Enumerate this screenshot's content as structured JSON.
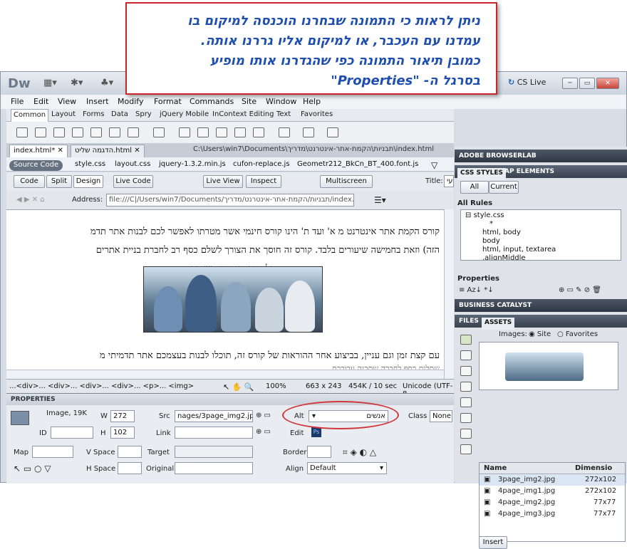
{
  "callout": {
    "lines": [
      "ניתן לראות כי התמונה שבחרנו הוכנסה למיקום בו",
      "עמדנו עם העכבר, או למיקום אליו גררנו אותה.",
      "כמובן תיאור התמונה כפי שהגדרנו אותו מופיע",
      "בסרגל ה- \"Properties\""
    ]
  },
  "app": {
    "logo": "Dw",
    "cs_live": "CS Live"
  },
  "menu": [
    "File",
    "Edit",
    "View",
    "Insert",
    "Modify",
    "Format",
    "Commands",
    "Site",
    "Window",
    "Help"
  ],
  "insert_tabs": [
    "Common",
    "Layout",
    "Forms",
    "Data",
    "Spry",
    "jQuery Mobile",
    "InContext Editing",
    "Text",
    "Favorites"
  ],
  "doc_tabs": [
    "index.html*",
    "הדגמה שליט.html"
  ],
  "doc_path": "C:\\Users\\win7\\Documents\\תבניות\\הקמת-אתר-אינטרנט\\מדריך\\index.html",
  "related_files": [
    "Source Code",
    "style.css",
    "layout.css",
    "jquery-1.3.2.min.js",
    "cufon-replace.js",
    "Geometr212_BkCn_BT_400.font.js"
  ],
  "view_buttons": [
    "Code",
    "Split",
    "Design",
    "Live Code",
    "Live View",
    "Inspect",
    "Multiscreen"
  ],
  "title_label": "Title:",
  "title_value": "עי",
  "address_label": "Address:",
  "address_value": "file:///C|/Users/win7/Documents/תבניות/הקמת-אתר-אינטרנט/מדריך/index.",
  "body_text": {
    "l1": "קורס הקמת אתר אינטרנט מ א' ועד ת' הינו קורס חינמי אשר מטרתו לאפשר לכם לבנות אתר תדמ",
    "l2": "הזה) וזאת בחמישה שיעורים בלבד. קורס זה חוסך את הצורך לשלם כסף רב לחברת בניית אתרים",
    "l3": "תלוי בה בעדכונו השוטף.",
    "l4": "עם קצת זמן וגם עניין, בביצוע אחר ההוראות של קורס זה, תוכלו לבנות בעצמכם אתר תדמיתי מ",
    "l5": "שתלום כסף לחברה שתבנה עבורכם"
  },
  "status": {
    "tags": "...<div>... <div>... <div>... <div>... <p>... <img>",
    "zoom": "100%",
    "dims": "663 x 243",
    "size": "454K / 10 sec",
    "encoding": "Unicode (UTF-8"
  },
  "properties": {
    "header": "PROPERTIES",
    "image_info": "Image, 19K",
    "w_label": "W",
    "w": "272",
    "h_label": "H",
    "h": "102",
    "id_label": "ID",
    "id": "",
    "src_label": "Src",
    "src": "nages/3page_img2.jpg",
    "link_label": "Link",
    "link": "",
    "alt_label": "Alt",
    "alt": "אנשים",
    "edit_label": "Edit",
    "class_label": "Class",
    "class": "None",
    "map_label": "Map",
    "vspace_label": "V Space",
    "hspace_label": "H Space",
    "target_label": "Target",
    "original_label": "Original",
    "border_label": "Border",
    "align_label": "Align",
    "align": "Default"
  },
  "right": {
    "browserlab": "ADOBE BROWSERLAB",
    "css_tab": "CSS STYLES",
    "ap_tab": "AP ELEMENTS",
    "all_btn": "All",
    "current_btn": "Current",
    "all_rules": "All Rules",
    "rules": [
      "style.css",
      "*",
      "html, body",
      "body",
      "html, input, textarea",
      ".alignMiddle"
    ],
    "properties": "Properties",
    "bc": "BUSINESS CATALYST",
    "files_tab": "FILES",
    "assets_tab": "ASSETS",
    "images_label": "Images:",
    "site": "Site",
    "favorites": "Favorites",
    "col_name": "Name",
    "col_dim": "Dimensio",
    "assets": [
      {
        "name": "3page_img2.jpg",
        "dim": "272x102"
      },
      {
        "name": "4page_img1.jpg",
        "dim": "272x102"
      },
      {
        "name": "4page_img2.jpg",
        "dim": "77x77"
      },
      {
        "name": "4page_img3.jpg",
        "dim": "77x77"
      }
    ],
    "insert": "Insert"
  }
}
